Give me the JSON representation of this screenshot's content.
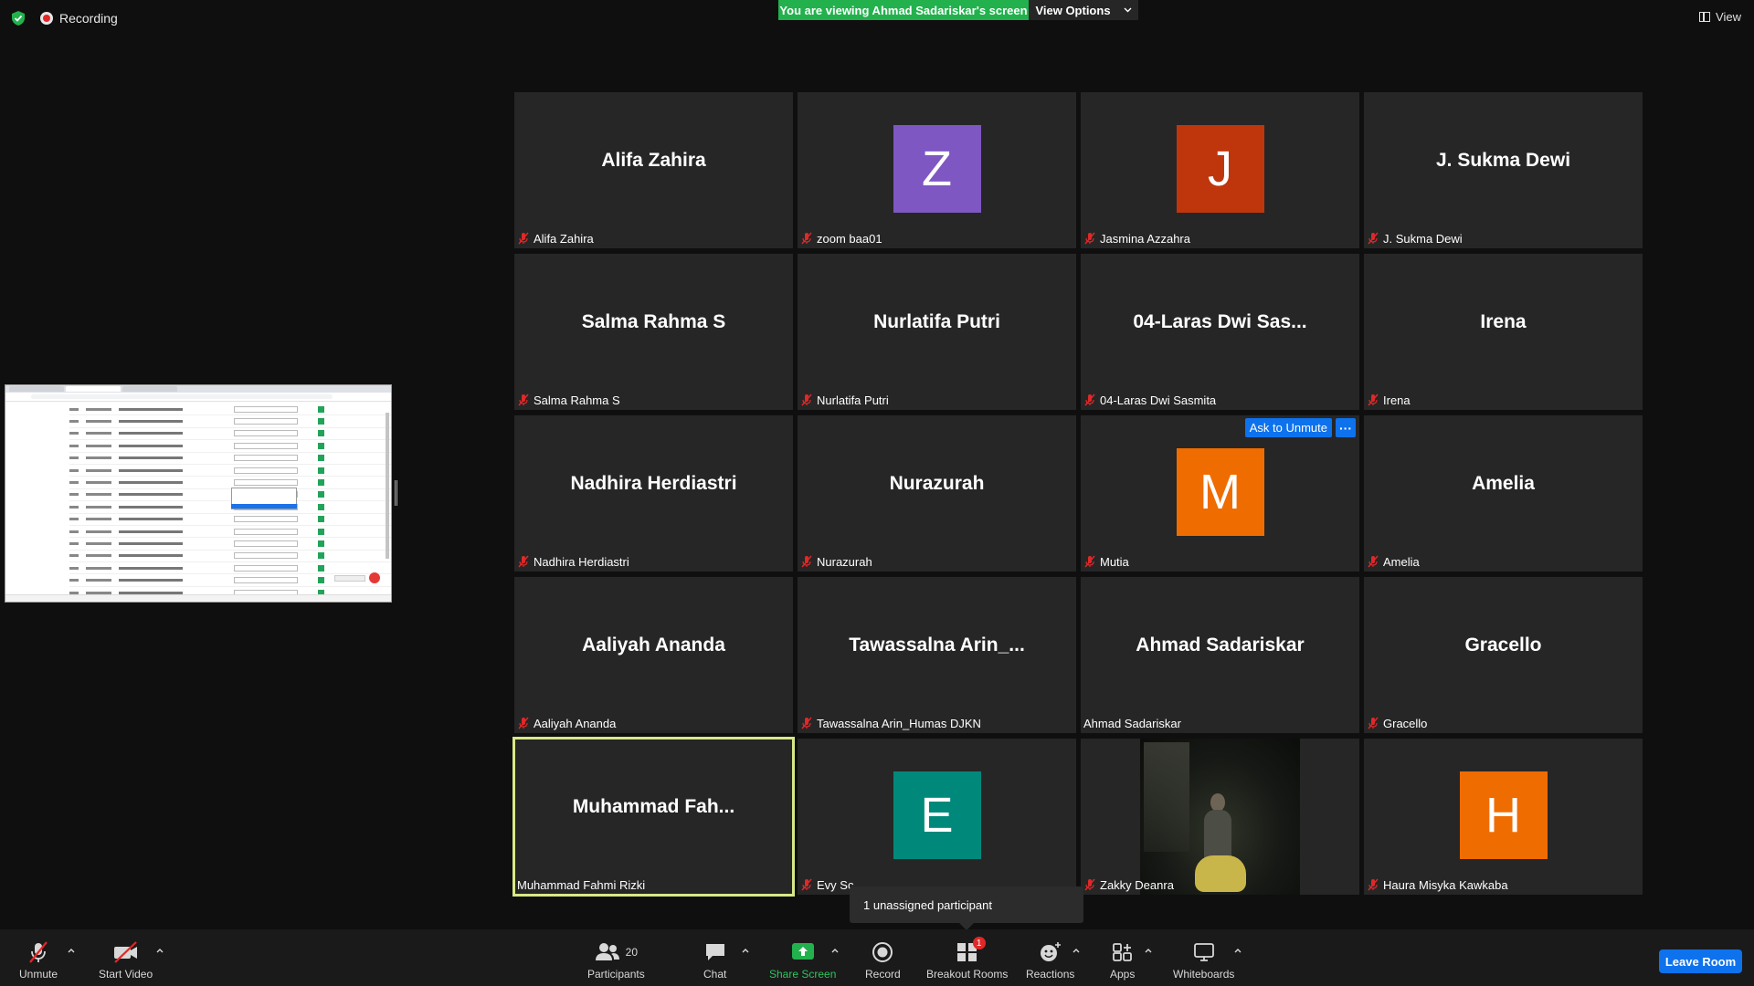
{
  "topbar": {
    "recording_label": "Recording",
    "viewing_banner": "You are viewing Ahmad Sadariskar's screen",
    "view_options_label": "View Options",
    "view_label": "View"
  },
  "tiles": [
    {
      "big": "Alifa Zahira",
      "name": "Alifa Zahira",
      "muted": true
    },
    {
      "initial": "Z",
      "avatar_color": "#7e57c2",
      "name": "zoom baa01",
      "muted": true
    },
    {
      "initial": "J",
      "avatar_color": "#bf360c",
      "name": "Jasmina Azzahra",
      "muted": true
    },
    {
      "big": "J. Sukma Dewi",
      "name": "J. Sukma Dewi",
      "muted": true
    },
    {
      "big": "Salma Rahma S",
      "name": "Salma Rahma S",
      "muted": true
    },
    {
      "big": "Nurlatifa Putri",
      "name": "Nurlatifa Putri",
      "muted": true
    },
    {
      "big": "04-Laras Dwi Sas...",
      "name": "04-Laras Dwi Sasmita",
      "muted": true
    },
    {
      "big": "Irena",
      "name": "Irena",
      "muted": true
    },
    {
      "big": "Nadhira Herdiastri",
      "name": "Nadhira Herdiastri",
      "muted": true
    },
    {
      "big": "Nurazurah",
      "name": "Nurazurah",
      "muted": true
    },
    {
      "initial": "M",
      "avatar_color": "#ef6c00",
      "name": "Mutia",
      "muted": true,
      "ask_unmute": "Ask to Unmute",
      "more": "···"
    },
    {
      "big": "Amelia",
      "name": "Amelia",
      "muted": true
    },
    {
      "big": "Aaliyah Ananda",
      "name": "Aaliyah Ananda",
      "muted": true
    },
    {
      "big": "Tawassalna  Arin_...",
      "name": "Tawassalna Arin_Humas DJKN",
      "muted": true
    },
    {
      "big": "Ahmad Sadariskar",
      "name": "Ahmad Sadariskar",
      "muted": false
    },
    {
      "big": "Gracello",
      "name": "Gracello",
      "muted": true
    },
    {
      "big": "Muhammad  Fah...",
      "name": "Muhammad Fahmi Rizki",
      "muted": false,
      "speaking": true
    },
    {
      "initial": "E",
      "avatar_color": "#00897b",
      "name": "Evy Sc",
      "muted": true
    },
    {
      "video": true,
      "name": "Zakky Deanra",
      "muted": true
    },
    {
      "initial": "H",
      "avatar_color": "#ef6c00",
      "name": "Haura Misyka Kawkaba",
      "muted": true
    }
  ],
  "popup": {
    "text": "1 unassigned participant"
  },
  "toolbar": {
    "unmute": "Unmute",
    "start_video": "Start Video",
    "participants": "Participants",
    "participants_count": "20",
    "chat": "Chat",
    "share_screen": "Share Screen",
    "record": "Record",
    "breakout_rooms": "Breakout Rooms",
    "breakout_badge": "1",
    "reactions": "Reactions",
    "apps": "Apps",
    "whiteboards": "Whiteboards",
    "leave_room": "Leave Room"
  },
  "colors": {
    "banner_green": "#23b14d",
    "accent_blue": "#0e72ed",
    "muted_red": "#e02828",
    "speaking_outline": "#d7e986"
  }
}
